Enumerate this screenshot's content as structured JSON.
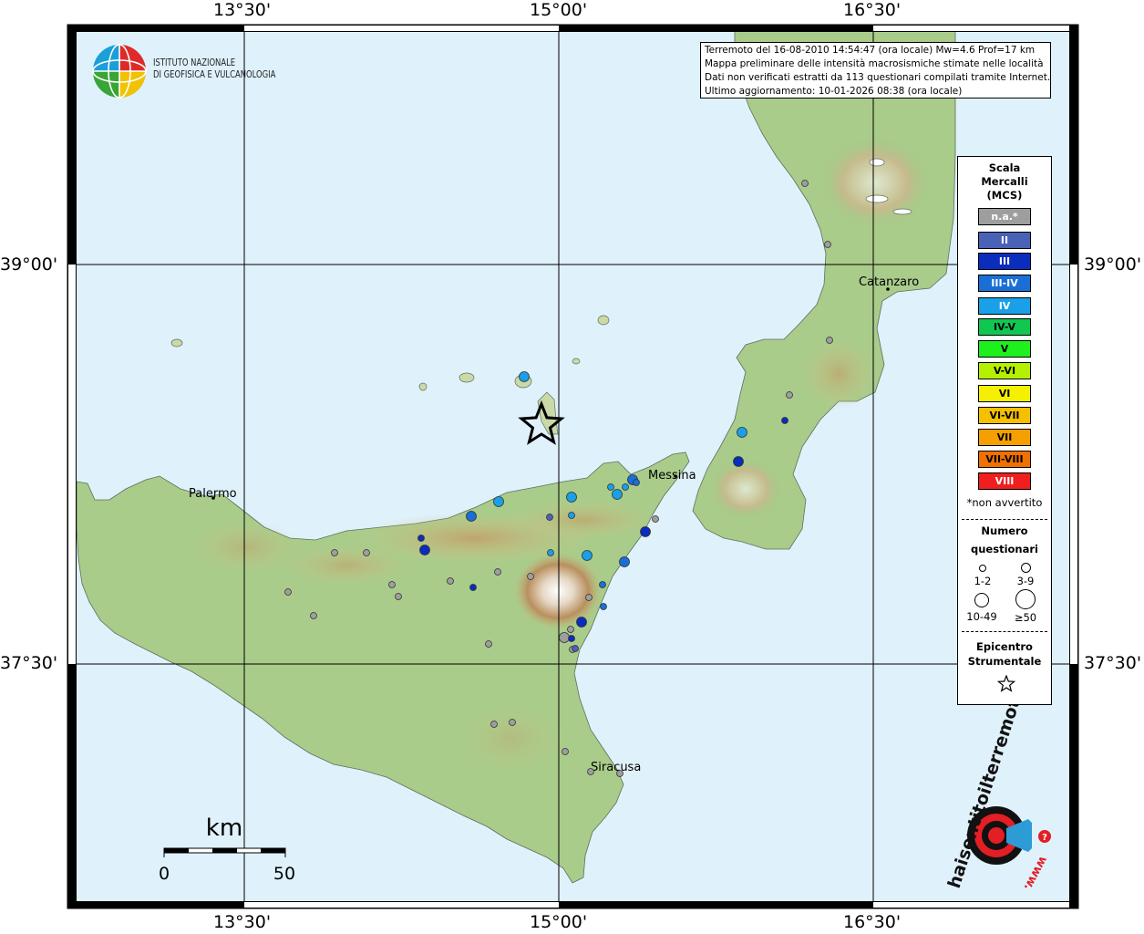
{
  "header": {
    "line1": "Terremoto del 16-08-2010 14:54:47 (ora locale) Mw=4.6 Prof=17 km",
    "line2": "Mappa preliminare delle intensità macrosismiche stimate nelle località",
    "line3": "Dati non verificati estratti da 113 questionari compilati tramite Internet.",
    "line4": "Ultimo aggiornamento: 10-01-2026 08:38 (ora locale)"
  },
  "logo_ingv": {
    "line1": "ISTITUTO NAZIONALE",
    "line2": "DI GEOFISICA E VULCANOLOGIA"
  },
  "logo_hsit": {
    "text": "haisentitoilterremoto.it",
    "prefix": "www."
  },
  "coords": {
    "top": [
      "13°30'",
      "15°00'",
      "16°30'"
    ],
    "bottom": [
      "13°30'",
      "15°00'",
      "16°30'"
    ],
    "left": [
      "39°00'",
      "37°30'"
    ],
    "right": [
      "39°00'",
      "37°30'"
    ]
  },
  "places": {
    "palermo": "Palermo",
    "messina": "Messina",
    "catanzaro": "Catanzaro",
    "siracusa": "Siracusa"
  },
  "scalebar": {
    "unit": "km",
    "min": "0",
    "max": "50"
  },
  "legend": {
    "title1": "Scala",
    "title2": "Mercalli",
    "title3": "(MCS)",
    "classes": [
      {
        "label": "n.a.*",
        "color": "#9e9e9e",
        "text": "#ffffff"
      },
      {
        "label": "II",
        "color": "#4a62b5",
        "text": "#ffffff"
      },
      {
        "label": "III",
        "color": "#0a2dbd",
        "text": "#ffffff"
      },
      {
        "label": "III-IV",
        "color": "#1a6fd6",
        "text": "#ffffff"
      },
      {
        "label": "IV",
        "color": "#1aa0e8",
        "text": "#ffffff"
      },
      {
        "label": "IV-V",
        "color": "#10c850",
        "text": "#000000"
      },
      {
        "label": "V",
        "color": "#1ef01e",
        "text": "#000000"
      },
      {
        "label": "V-VI",
        "color": "#b4f000",
        "text": "#000000"
      },
      {
        "label": "VI",
        "color": "#f5f000",
        "text": "#000000"
      },
      {
        "label": "VI-VII",
        "color": "#f5c000",
        "text": "#000000"
      },
      {
        "label": "VII",
        "color": "#f5a000",
        "text": "#000000"
      },
      {
        "label": "VII-VIII",
        "color": "#f07000",
        "text": "#000000"
      },
      {
        "label": "VIII",
        "color": "#f01e1e",
        "text": "#ffffff"
      }
    ],
    "note": "*non avvertito",
    "num_head1": "Numero",
    "num_head2": "questionari",
    "sizes": [
      "1-2",
      "3-9",
      "10-49",
      "≥50"
    ],
    "epi_head1": "Epicentro",
    "epi_head2": "Strumentale"
  }
}
